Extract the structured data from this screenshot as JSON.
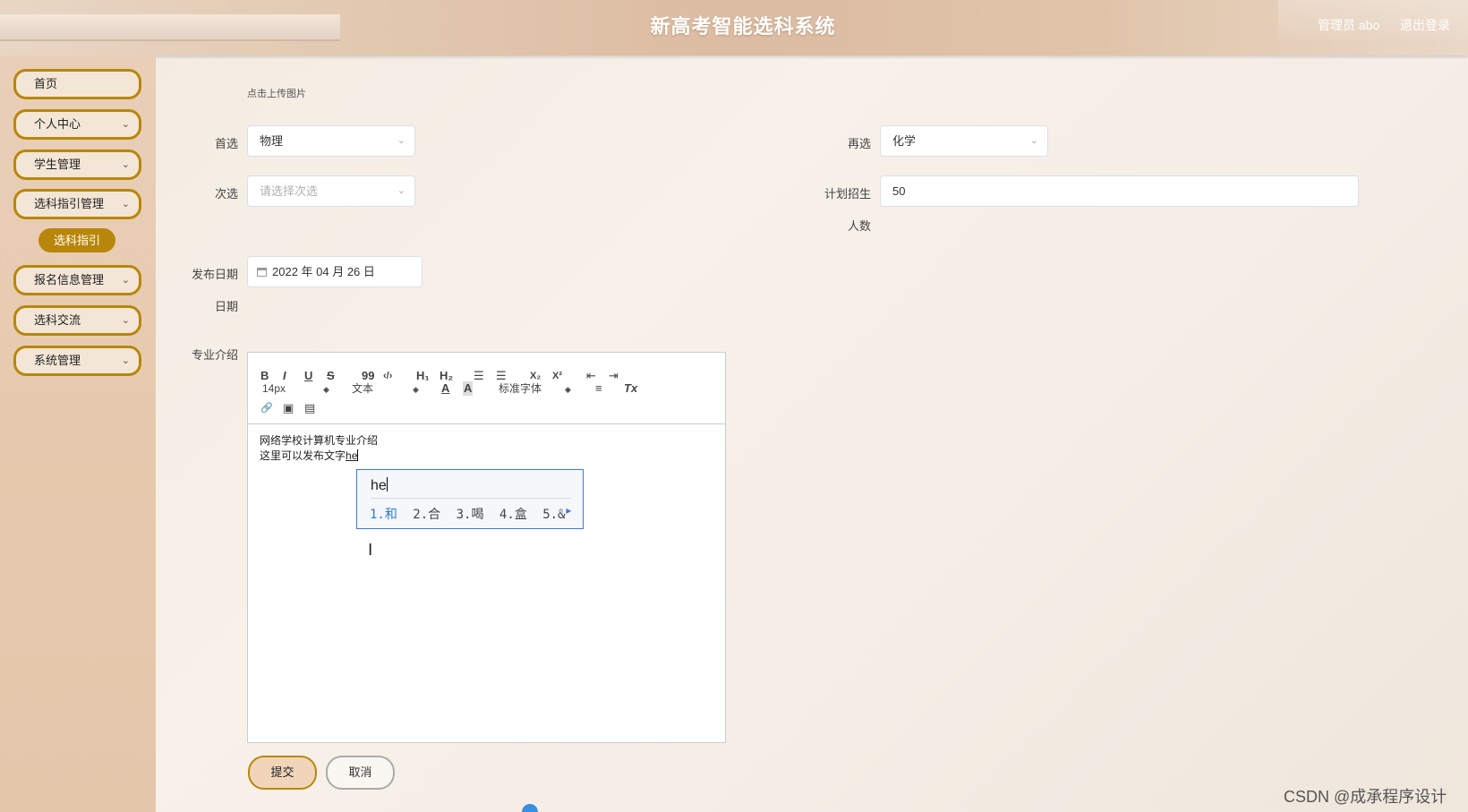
{
  "header": {
    "title": "新高考智能选科系统",
    "user": "管理员 abo",
    "logout": "退出登录"
  },
  "sidebar": {
    "items": [
      {
        "label": "首页"
      },
      {
        "label": "个人中心"
      },
      {
        "label": "学生管理"
      },
      {
        "label": "选科指引管理"
      },
      {
        "label": "报名信息管理"
      },
      {
        "label": "选科交流"
      },
      {
        "label": "系统管理"
      }
    ],
    "sub_item": "选科指引"
  },
  "form": {
    "upload_hint": "点击上传图片",
    "first_choice": {
      "label": "首选",
      "value": "物理"
    },
    "second_choice": {
      "label": "次选",
      "placeholder": "请选择次选"
    },
    "re_choice": {
      "label": "再选",
      "value": "化学"
    },
    "plan_enroll": {
      "label_line1": "计划招生",
      "label_line2": "人数",
      "value": "50"
    },
    "publish_date": {
      "label_line1": "发布日期",
      "label_line2": "日期",
      "value": "2022 年 04 月 26 日"
    },
    "intro": {
      "label": "专业介绍"
    }
  },
  "editor": {
    "toolbar": {
      "bold": "B",
      "italic": "I",
      "underline": "U",
      "strike": "S",
      "quote": "99",
      "code": "‹/›",
      "h1": "H₁",
      "h2": "H₂",
      "ordered_list": "☰",
      "bullet_list": "☰",
      "sub": "X₂",
      "sup": "X²",
      "outdent": "⇤",
      "indent": "⇥",
      "font_size": "14px",
      "block_type": "文本",
      "font_color": "A",
      "background": "A",
      "font_family": "标准字体",
      "align": "≡",
      "clear_format": "Tx",
      "link": "🔗",
      "image": "▣",
      "video": "▤"
    },
    "content_line1": "网络学校计算机专业介绍",
    "content_line2_prefix": "这里可以发布文字",
    "content_line2_typing": "he"
  },
  "ime": {
    "composition": "he",
    "candidates": [
      "1.和",
      "2.合",
      "3.喝",
      "4.盒",
      "5.&"
    ],
    "prev": "◂",
    "next": "▸"
  },
  "buttons": {
    "submit": "提交",
    "cancel": "取消"
  },
  "watermark": "CSDN @成承程序设计"
}
